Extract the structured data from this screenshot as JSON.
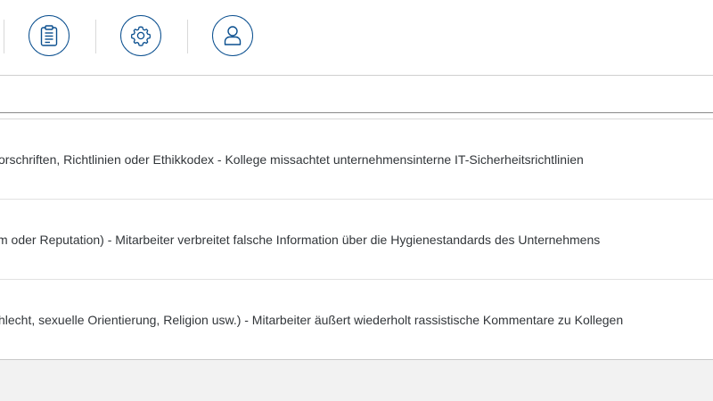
{
  "toolbar": {
    "buttons": [
      {
        "icon": "clipboard-icon"
      },
      {
        "icon": "gear-icon"
      },
      {
        "icon": "user-icon"
      }
    ],
    "accent_color": "#0a4f8f"
  },
  "search": {
    "value": "",
    "placeholder": ""
  },
  "list": {
    "items": [
      {
        "text": "orschriften, Richtlinien oder Ethikkodex - Kollege missachtet unternehmensinterne IT-Sicherheitsrichtlinien"
      },
      {
        "text": "m oder Reputation) - Mitarbeiter verbreitet falsche Information über die Hygienestandards des Unternehmens"
      },
      {
        "text": "hlecht, sexuelle Orientierung, Religion usw.) - Mitarbeiter äußert wiederholt rassistische Kommentare zu Kollegen"
      }
    ]
  }
}
